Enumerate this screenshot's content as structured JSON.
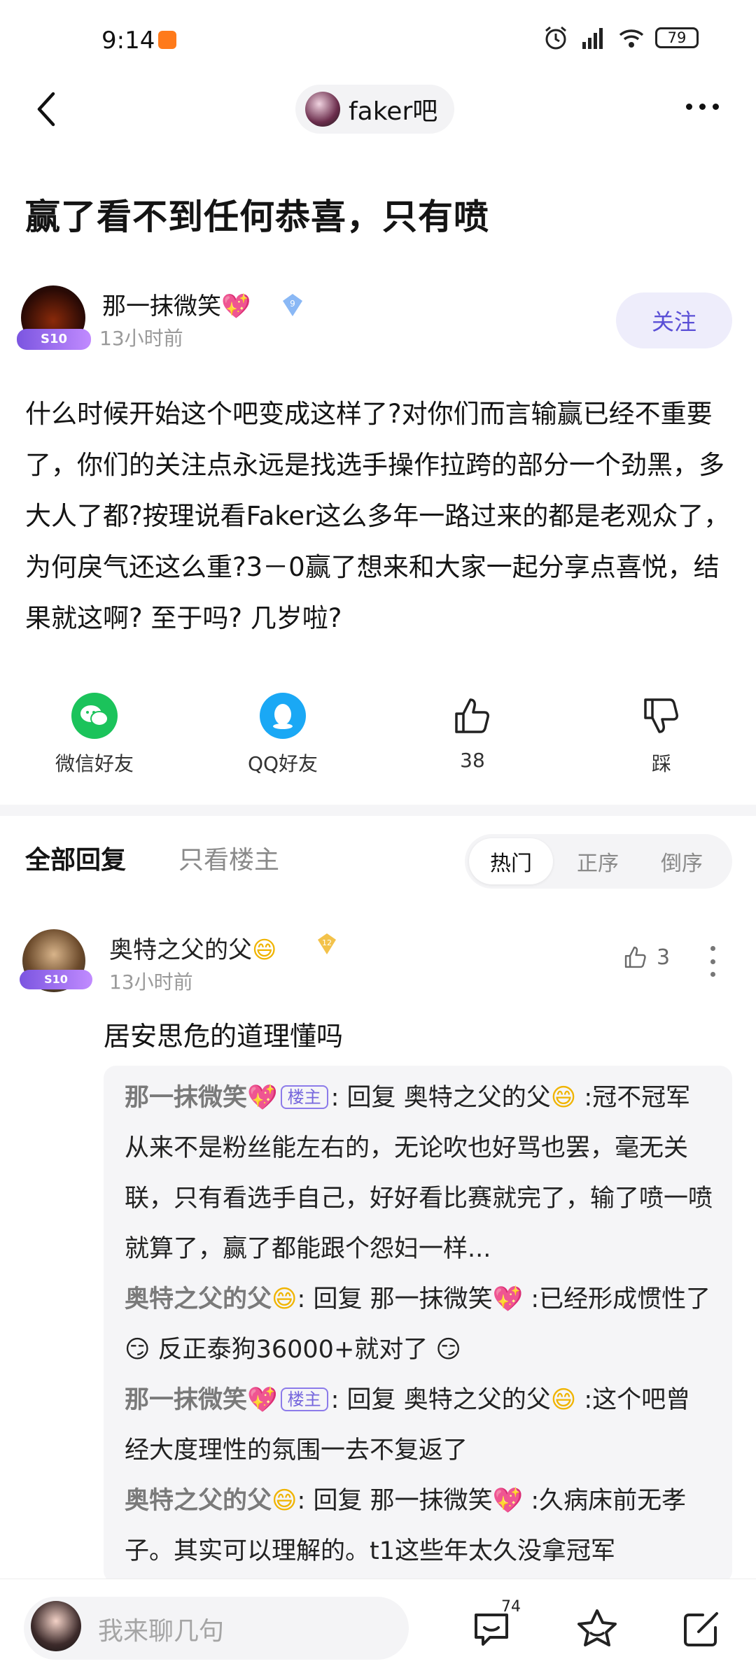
{
  "status_bar": {
    "time": "9:14",
    "battery": "79"
  },
  "nav": {
    "forum_name": "faker吧"
  },
  "post": {
    "title": "赢了看不到任何恭喜，只有喷",
    "author": {
      "name": "那一抹微笑",
      "emoji": "💖",
      "level": "9",
      "time": "13小时前",
      "badge": "S10"
    },
    "follow_label": "关注",
    "body": "什么时候开始这个吧变成这样了?对你们而言输赢已经不重要了，你们的关注点永远是找选手操作拉跨的部分一个劲黑，多大人了都?按理说看Faker这么多年一路过来的都是老观众了，为何戾气还这么重?3－0赢了想来和大家一起分享点喜悦，结果就这啊? 至于吗? 几岁啦?"
  },
  "actions": {
    "wechat_label": "微信好友",
    "qq_label": "QQ好友",
    "like_count": "38",
    "dislike_label": "踩"
  },
  "tabs": {
    "all": "全部回复",
    "op_only": "只看楼主",
    "sort": {
      "hot": "热门",
      "asc": "正序",
      "desc": "倒序"
    }
  },
  "comment": {
    "name": "奥特之父的父",
    "name_emoji": "😄",
    "level": "12",
    "badge": "S10",
    "time": "13小时前",
    "likes": "3",
    "text": "居安思危的道理懂吗",
    "replies": [
      {
        "name": "那一抹微笑",
        "emoji": "💖",
        "is_op": true,
        "op_tag": "楼主",
        "reply_word": "回复",
        "to": "奥特之父的父",
        "to_emoji": "😄",
        "text": "冠不冠军从来不是粉丝能左右的，无论吹也好骂也罢，毫无关联，只有看选手自己，好好看比赛就完了，输了喷一喷就算了，赢了都能跟个怨妇一样..."
      },
      {
        "name": "奥特之父的父",
        "emoji": "😄",
        "is_op": false,
        "reply_word": "回复",
        "to": "那一抹微笑",
        "to_emoji": "💖",
        "text": "已经形成惯性了 😏 反正泰狗36000+就对了 😏"
      },
      {
        "name": "那一抹微笑",
        "emoji": "💖",
        "is_op": true,
        "op_tag": "楼主",
        "reply_word": "回复",
        "to": "奥特之父的父",
        "to_emoji": "😄",
        "text": "这个吧曾经大度理性的氛围一去不复返了"
      },
      {
        "name": "奥特之父的父",
        "emoji": "😄",
        "is_op": false,
        "reply_word": "回复",
        "to": "那一抹微笑",
        "to_emoji": "💖",
        "text": "久病床前无孝子。其实可以理解的。t1这些年太久没拿冠军"
      }
    ]
  },
  "bottom": {
    "input_placeholder": "我来聊几句",
    "comment_count": "74"
  },
  "colors": {
    "accent": "#5a4fd6",
    "wechat": "#1bc35b",
    "qq": "#1aa8f5",
    "heart": "#ff4f9e"
  }
}
